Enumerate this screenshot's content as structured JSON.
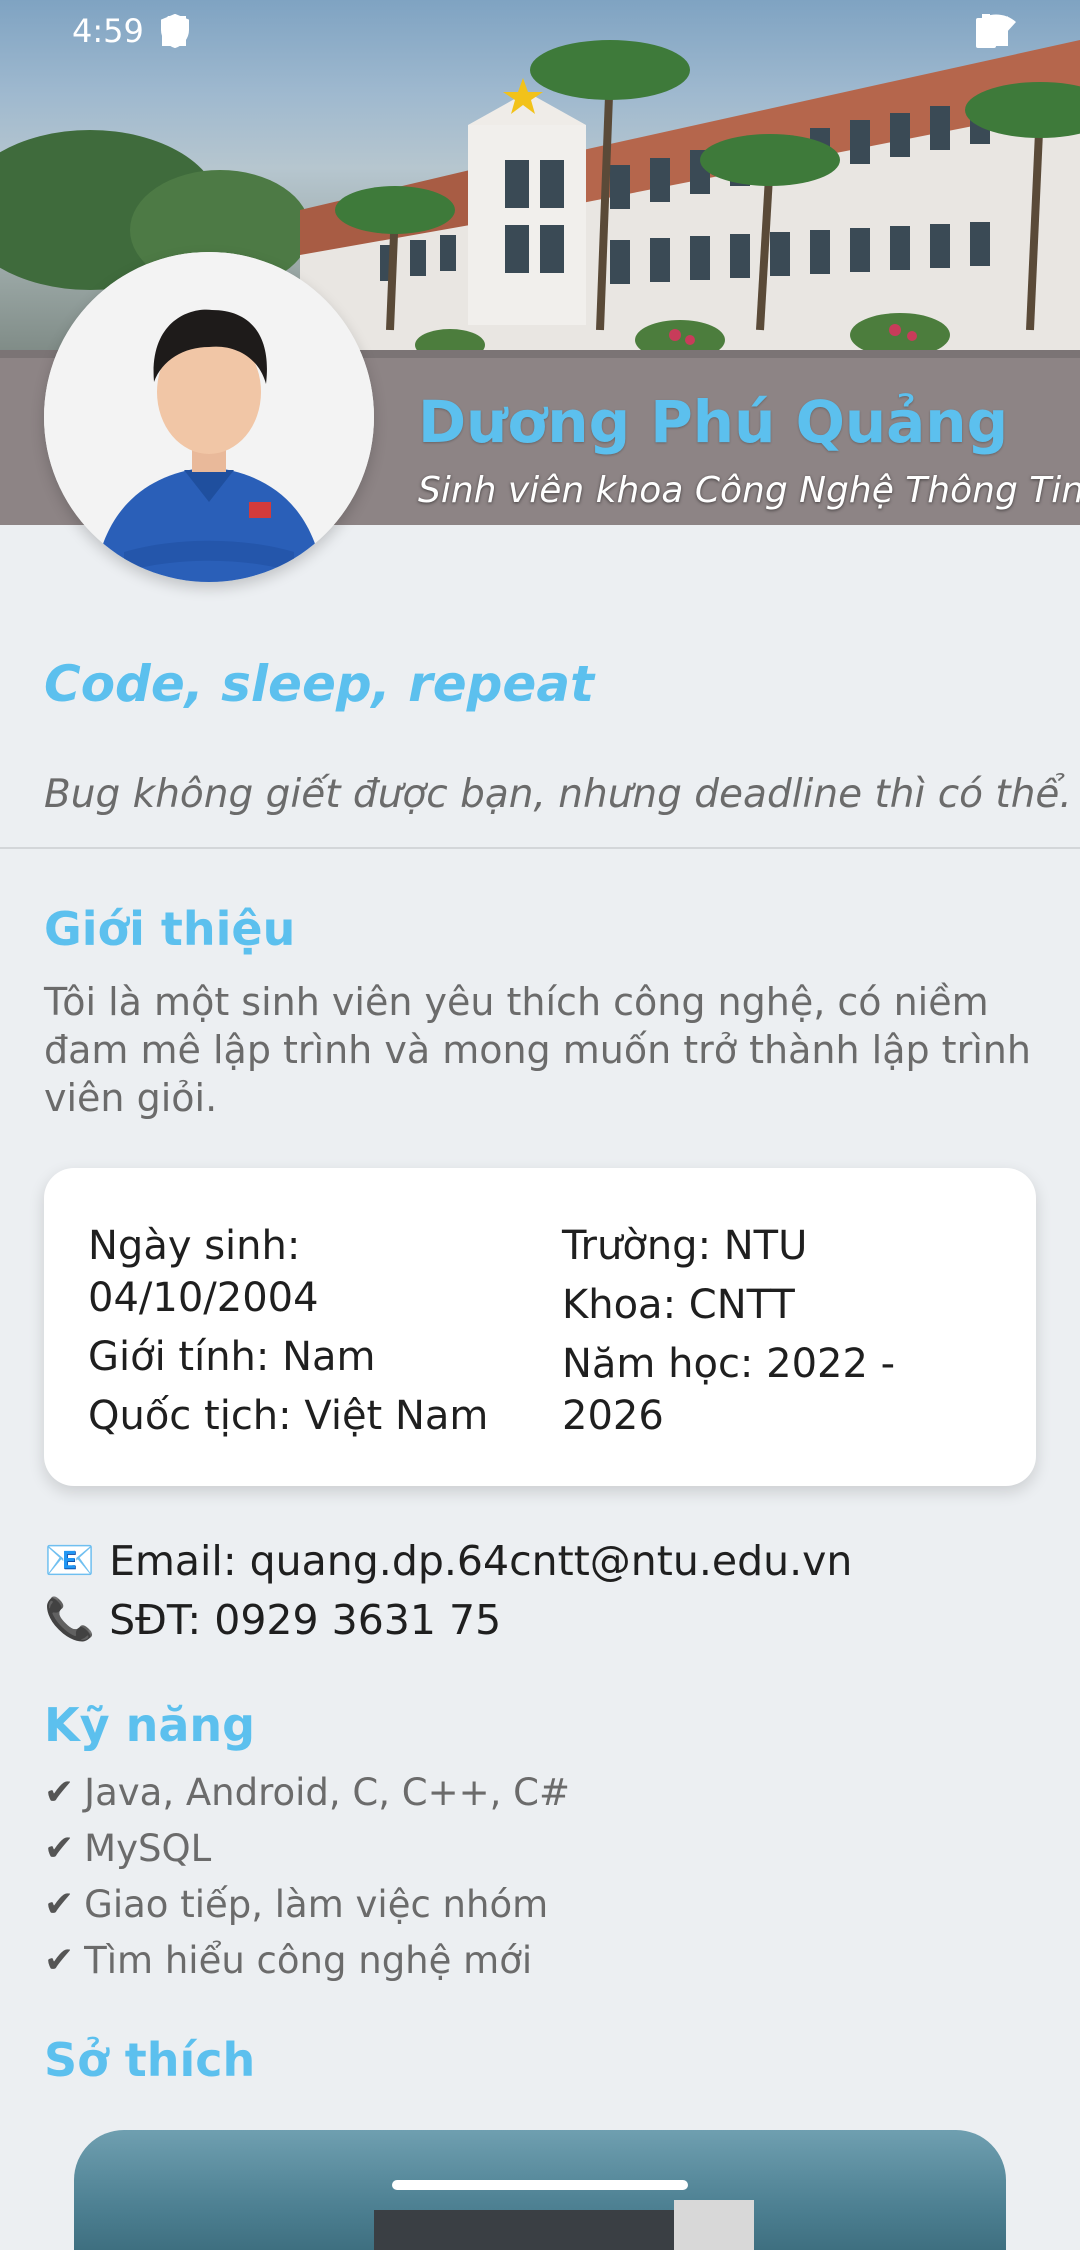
{
  "status_bar": {
    "time": "4:59",
    "left_icons": [
      "shield-icon",
      "sd-card-icon"
    ],
    "right_icons": [
      "wifi-icon",
      "signal-icon",
      "battery-icon"
    ]
  },
  "profile": {
    "name": "Dương Phú Quảng",
    "subtitle": "Sinh viên khoa Công Nghệ Thông Tin"
  },
  "motto": "Code, sleep, repeat",
  "quote": "Bug không giết được bạn, nhưng deadline thì có thể.",
  "intro": {
    "title": "Giới thiệu",
    "text": "Tôi là một sinh viên yêu thích công nghệ, có niềm đam mê lập trình và mong muốn trở thành lập trình viên giỏi."
  },
  "info": {
    "left": [
      "Ngày sinh: 04/10/2004",
      "Giới tính: Nam",
      "Quốc tịch: Việt Nam"
    ],
    "right": [
      "Trường: NTU",
      "Khoa: CNTT",
      "Năm học: 2022 - 2026"
    ]
  },
  "contact": {
    "email_icon": "📧",
    "email": "Email: quang.dp.64cntt@ntu.edu.vn",
    "phone_icon": "📞",
    "phone": "SĐT: 0929 3631 75"
  },
  "skills": {
    "title": "Kỹ năng",
    "check": "✔",
    "items": [
      "Java, Android, C, C++, C#",
      "MySQL",
      "Giao tiếp, làm việc nhóm",
      "Tìm hiểu công nghệ mới"
    ]
  },
  "hobbies": {
    "title": "Sở thích"
  },
  "colors": {
    "accent": "#5cc0ee",
    "background": "#eceff2",
    "card": "#ffffff",
    "muted_text": "#6b6b6b"
  }
}
